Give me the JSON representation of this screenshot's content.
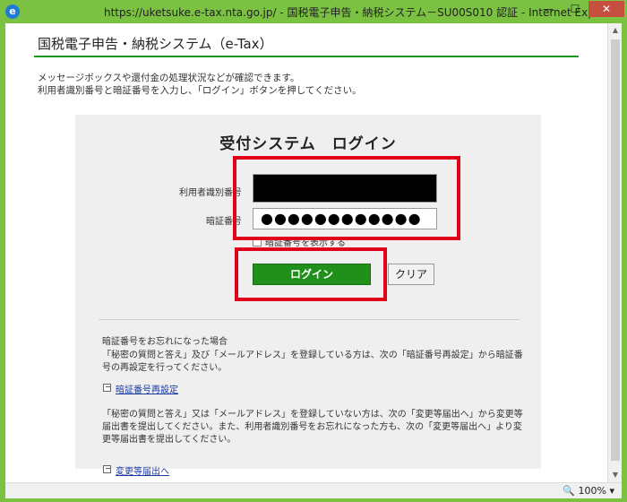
{
  "window": {
    "ie_icon": "e",
    "title": "https://uketsuke.e-tax.nta.go.jp/ - 国税電子申告・納税システム－SU00S010 認証 - Internet Explorer",
    "minimize": "—",
    "maximize": "☐",
    "close": "✕"
  },
  "page": {
    "header_title": "国税電子申告・納税システム（e-Tax）",
    "intro_line1": "メッセージボックスや還付金の処理状況などが確認できます。",
    "intro_line2": "利用者識別番号と暗証番号を入力し、「ログイン」ボタンを押してください。"
  },
  "login": {
    "title": "受付システム　ログイン",
    "user_id_label": "利用者識別番号",
    "user_id_value": "",
    "password_label": "暗証番号",
    "password_value": "●●●●●●●●●●●●",
    "show_password_label": "暗証番号を表示する",
    "login_button": "ログイン",
    "clear_button": "クリア"
  },
  "help": {
    "heading": "暗証番号をお忘れになった場合",
    "para1": "「秘密の質問と答え」及び「メールアドレス」を登録している方は、次の「暗証番号再設定」から暗証番号の再設定を行ってください。",
    "link1": "暗証番号再設定",
    "para2": "「秘密の質問と答え」又は「メールアドレス」を登録していない方は、次の「変更等届出へ」から変更等届出書を提出してください。また、利用者識別番号をお忘れになった方も、次の「変更等届出へ」より変更等届出書を提出してください。",
    "link2": "変更等届出へ"
  },
  "statusbar": {
    "zoom": "100%"
  },
  "scrollbar": {
    "up": "▲",
    "down": "▼"
  }
}
